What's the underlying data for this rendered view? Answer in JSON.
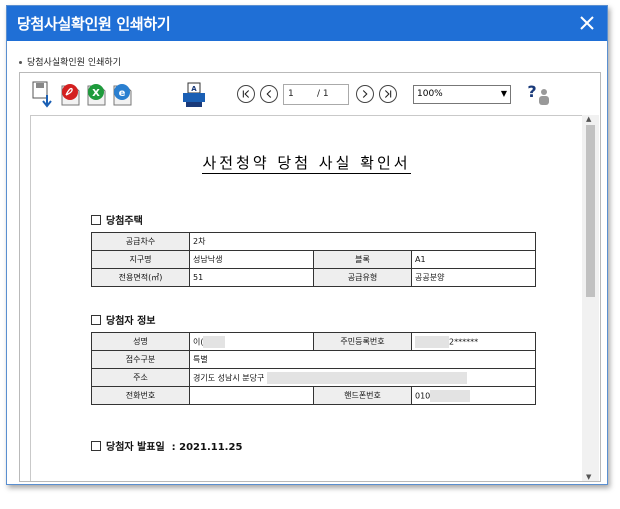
{
  "dialog": {
    "title": "당첨사실확인원 인쇄하기",
    "breadcrumb": "당첨사실확인원 인쇄하기"
  },
  "toolbar": {
    "icons": [
      "save-icon",
      "pdf-export-icon",
      "excel-export-icon",
      "hwp-export-icon",
      "print-icon",
      "help-icon"
    ],
    "page_current": "1",
    "page_total": "/ 1",
    "zoom": "100%",
    "colors": {
      "pdf": "#d42020",
      "excel": "#1e9b3c",
      "hwp": "#2a7fd0",
      "navy": "#1a3a7a"
    }
  },
  "document": {
    "title": "사전청약 당첨 사실 확인서",
    "house": {
      "heading": "당첨주택",
      "rows": [
        {
          "label": "공급차수",
          "value": "2차"
        },
        {
          "label": "지구명",
          "value": "성남낙생",
          "label2": "블록",
          "value2": "A1"
        },
        {
          "label": "전용면적(㎡)",
          "value": "51",
          "label2": "공급유형",
          "value2": "공공분양"
        }
      ]
    },
    "winner": {
      "heading": "당첨자 정보",
      "rows": [
        {
          "label": "성명",
          "value": "이(",
          "label2": "주민등록번호",
          "value2": "2******"
        },
        {
          "label": "접수구분",
          "value": "특별"
        },
        {
          "label": "주소",
          "value": "경기도 성남시 분당구"
        },
        {
          "label": "전화번호",
          "value": "",
          "label2": "핸드폰번호",
          "value2": "010"
        }
      ]
    },
    "announce_label": "당첨자 발표일",
    "announce_date": ": 2021.11.25"
  }
}
